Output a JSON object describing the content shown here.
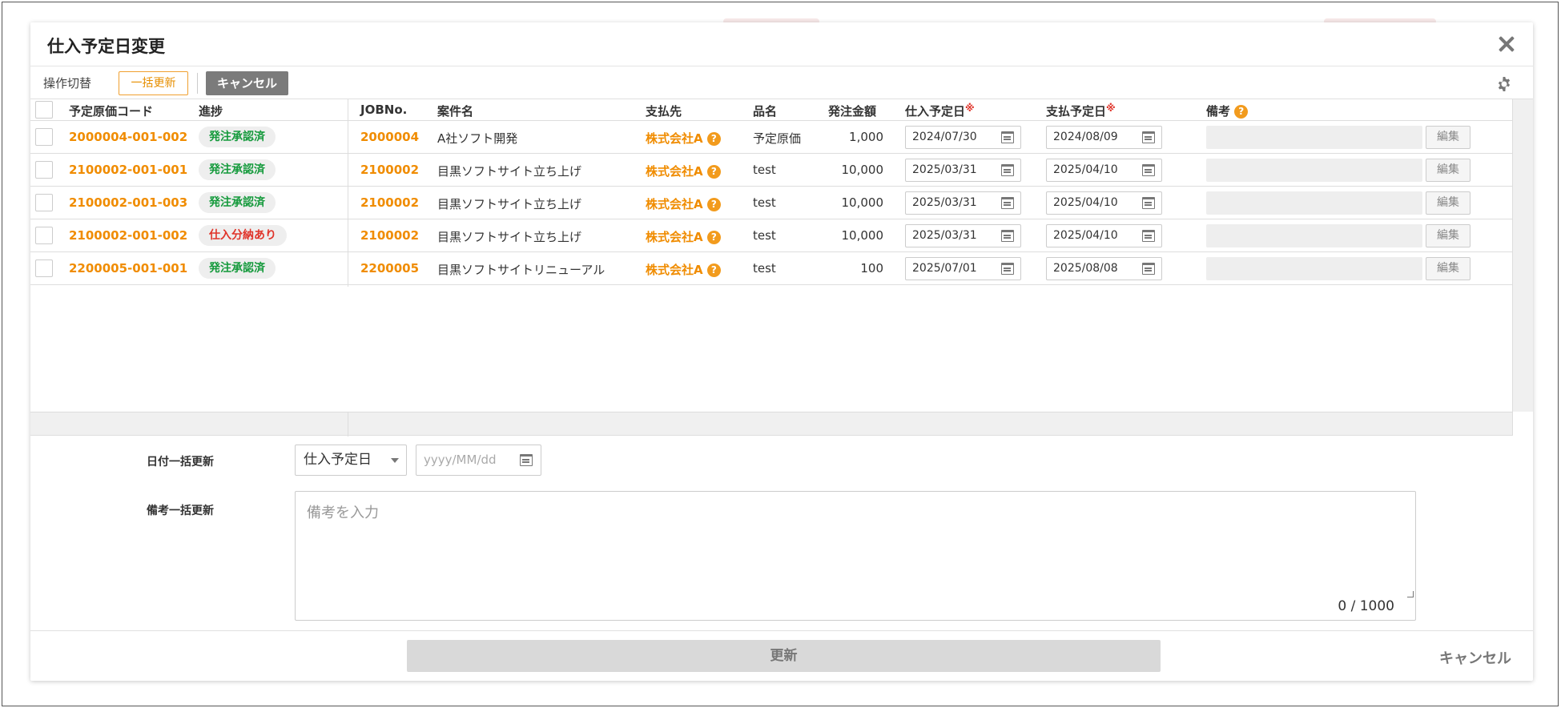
{
  "modal": {
    "title": "仕入予定日変更"
  },
  "toolbar": {
    "mode_label": "操作切替",
    "bulk_update_label": "一括更新",
    "cancel_label": "キャンセル"
  },
  "table": {
    "columns": {
      "code": "予定原価コード",
      "progress": "進捗",
      "job_no": "JOBNo.",
      "project": "案件名",
      "payee": "支払先",
      "item": "品名",
      "amount": "発注金額",
      "purchase_date": "仕入予定日",
      "payment_date": "支払予定日",
      "memo": "備考",
      "required_mark": "※",
      "help_mark": "?"
    },
    "edit_label": "編集",
    "rows": [
      {
        "code": "2000004-001-002",
        "progress": "発注承認済",
        "progress_status": "ok",
        "job_no": "2000004",
        "project": "A社ソフト開発",
        "payee": "株式会社A",
        "item": "予定原価",
        "amount": "1,000",
        "purchase_date": "2024/07/30",
        "payment_date": "2024/08/09"
      },
      {
        "code": "2100002-001-001",
        "progress": "発注承認済",
        "progress_status": "ok",
        "job_no": "2100002",
        "project": "目黒ソフトサイト立ち上げ",
        "payee": "株式会社A",
        "item": "test",
        "amount": "10,000",
        "purchase_date": "2025/03/31",
        "payment_date": "2025/04/10"
      },
      {
        "code": "2100002-001-003",
        "progress": "発注承認済",
        "progress_status": "ok",
        "job_no": "2100002",
        "project": "目黒ソフトサイト立ち上げ",
        "payee": "株式会社A",
        "item": "test",
        "amount": "10,000",
        "purchase_date": "2025/03/31",
        "payment_date": "2025/04/10"
      },
      {
        "code": "2100002-001-002",
        "progress": "仕入分納あり",
        "progress_status": "ng",
        "job_no": "2100002",
        "project": "目黒ソフトサイト立ち上げ",
        "payee": "株式会社A",
        "item": "test",
        "amount": "10,000",
        "purchase_date": "2025/03/31",
        "payment_date": "2025/04/10"
      },
      {
        "code": "2200005-001-001",
        "progress": "発注承認済",
        "progress_status": "ok",
        "job_no": "2200005",
        "project": "目黒ソフトサイトリニューアル",
        "payee": "株式会社A",
        "item": "test",
        "amount": "100",
        "purchase_date": "2025/07/01",
        "payment_date": "2025/08/08"
      }
    ]
  },
  "bulk": {
    "date_label": "日付一括更新",
    "date_target": "仕入予定日",
    "date_placeholder": "yyyy/MM/dd",
    "memo_label": "備考一括更新",
    "memo_placeholder": "備考を入力",
    "memo_counter": "0 / 1000"
  },
  "footer": {
    "update_label": "更新",
    "cancel_label": "キャンセル"
  },
  "colors": {
    "accent_orange": "#f08c00",
    "status_ok": "#159a3c",
    "status_ng": "#e0342a"
  }
}
